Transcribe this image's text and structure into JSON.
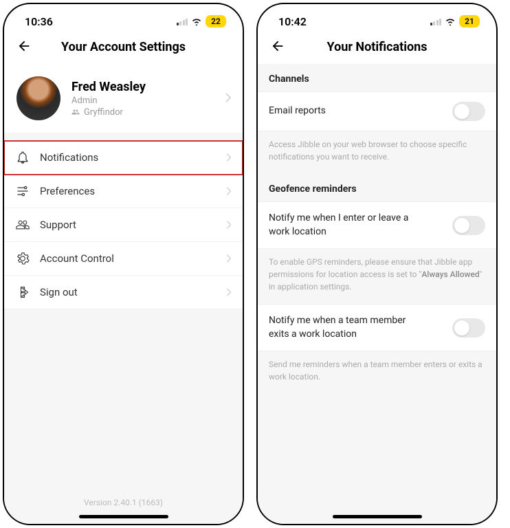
{
  "screen1": {
    "time": "10:36",
    "battery": "22",
    "title": "Your Account Settings",
    "profile": {
      "name": "Fred Weasley",
      "role": "Admin",
      "group": "Gryffindor"
    },
    "menu": {
      "notifications": "Notifications",
      "preferences": "Preferences",
      "support": "Support",
      "account_control": "Account Control",
      "sign_out": "Sign out"
    },
    "version": "Version 2.40.1 (1663)"
  },
  "screen2": {
    "time": "10:42",
    "battery": "21",
    "title": "Your Notifications",
    "sections": {
      "channels": {
        "header": "Channels",
        "email_reports": "Email reports",
        "help": "Access Jibble on your web browser to choose specific notifications you want to receive."
      },
      "geofence": {
        "header": "Geofence reminders",
        "notify_self": "Notify me when I enter or leave a work location",
        "help_self_1": "To enable GPS reminders, please ensure that Jibble app permissions for location access is set to \"",
        "help_self_emphasis": "Always Allowed",
        "help_self_2": "\" in application settings.",
        "notify_team": "Notify me when a team member exits a work location",
        "help_team": "Send me reminders when a team member enters or exits a work location."
      }
    }
  }
}
